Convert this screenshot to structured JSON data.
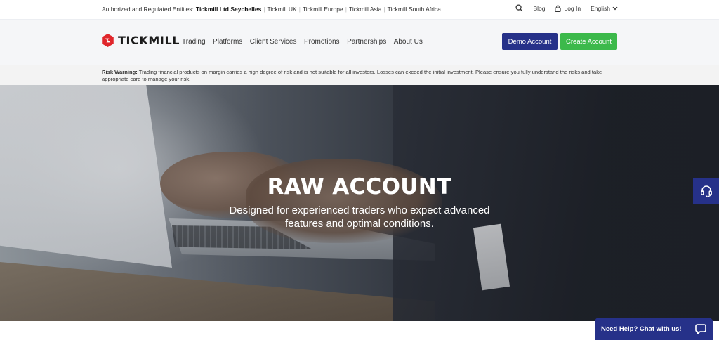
{
  "topbar": {
    "entities_label": "Authorized and Regulated Entities:",
    "entities": [
      {
        "label": "Tickmill Ltd Seychelles",
        "active": true
      },
      {
        "label": "Tickmill UK",
        "active": false
      },
      {
        "label": "Tickmill Europe",
        "active": false
      },
      {
        "label": "Tickmill Asia",
        "active": false
      },
      {
        "label": "Tickmill South Africa",
        "active": false
      }
    ],
    "blog": "Blog",
    "login": "Log In",
    "language": "English"
  },
  "header": {
    "brand": "TICKMILL",
    "menu": [
      "Trading",
      "Platforms",
      "Client Services",
      "Promotions",
      "Partnerships",
      "About Us"
    ],
    "demo_button": "Demo Account",
    "create_button": "Create Account"
  },
  "risk": {
    "label": "Risk Warning:",
    "text": "Trading financial products on margin carries a high degree of risk and is not suitable for all investors. Losses can exceed the initial investment. Please ensure you fully understand the risks and take appropriate care to manage your risk."
  },
  "hero": {
    "title": "RAW ACCOUNT",
    "subtitle": "Designed for experienced traders who expect advanced features and optimal conditions."
  },
  "chat": {
    "label": "Need Help? Chat with us!"
  },
  "colors": {
    "primary_navy": "#263189",
    "accent_green": "#3cb94b",
    "brand_red": "#e0262b"
  },
  "icons": [
    "search-icon",
    "lock-icon",
    "chevron-down-icon",
    "tickmill-logo-icon",
    "headset-icon",
    "chat-bubble-icon"
  ]
}
